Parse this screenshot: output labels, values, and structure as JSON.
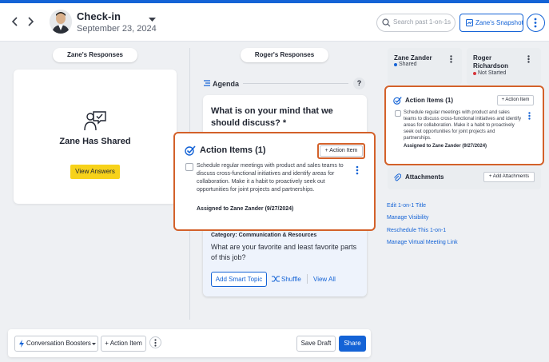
{
  "header": {
    "title": "Check-in",
    "date": "September 23, 2024",
    "search_placeholder": "Search past 1-on-1s",
    "snapshot_label": "Zane's Snapshot"
  },
  "left": {
    "responses_label": "Zane's Responses",
    "shared_title": "Zane Has Shared",
    "view_answers_label": "View Answers"
  },
  "middle": {
    "responses_label": "Roger's Responses",
    "agenda_label": "Agenda",
    "help_label": "?",
    "question": "What is on your mind that we should discuss? *",
    "category": "Category: Communication & Resources",
    "question2": "What are your favorite and least favorite parts of this job?",
    "add_smart_topic": "Add Smart Topic",
    "shuffle": "Shuffle",
    "view_all": "View All"
  },
  "action_items": {
    "title": "Action Items (1)",
    "add_label": "+ Action Item",
    "item_text": "Schedule regular meetings with product and sales teams to discuss cross-functional initiatives and identify areas for collaboration. Make it a habit to proactively seek out opportunities for joint projects and partnerships.",
    "assigned": "Assigned to Zane Zander (9/27/2024)"
  },
  "right": {
    "users": [
      {
        "name": "Zane Zander",
        "status": "Shared",
        "status_color": "#1463d6"
      },
      {
        "name": "Roger Richardson",
        "status": "Not Started",
        "status_color": "#d6343a"
      }
    ],
    "attachments_title": "Attachments",
    "add_attachments": "+ Add Attachments",
    "links": [
      "Edit 1-on-1 Title",
      "Manage Visibility",
      "Reschedule This 1-on-1",
      "Manage Virtual Meeting Link"
    ]
  },
  "footer": {
    "boosters_label": "Conversation Boosters",
    "action_item_label": "+ Action Item",
    "save_draft": "Save Draft",
    "share": "Share"
  },
  "colors": {
    "accent": "#1463d6",
    "highlight": "#d3612a",
    "yellow": "#f7d21a"
  }
}
